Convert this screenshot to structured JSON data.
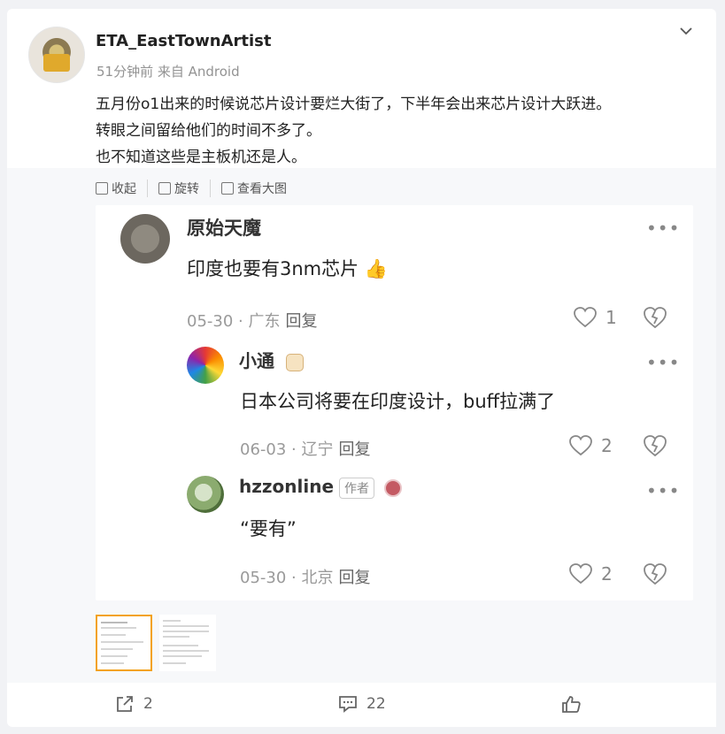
{
  "post": {
    "username": "ETA_EastTownArtist",
    "meta": "51分钟前 来自 Android",
    "lines": [
      "五月份o1出来的时候说芯片设计要烂大街了，下半年会出来芯片设计大跃进。",
      "转眼之间留给他们的时间不多了。",
      "也不知道这些是主板机还是人。"
    ]
  },
  "image_toolbar": {
    "collapse": "收起",
    "rotate": "旋转",
    "view_large": "查看大图"
  },
  "comments": [
    {
      "name": "原始天魔",
      "text": "印度也要有3nm芯片",
      "emoji": "👍",
      "meta": "05-30 · 广东",
      "reply": "回复",
      "likes": "1"
    },
    {
      "name": "小通",
      "text": "日本公司将要在印度设计，buff拉满了",
      "meta": "06-03 · 辽宁",
      "reply": "回复",
      "likes": "2"
    },
    {
      "name": "hzzonline",
      "badge": "作者",
      "text": "“要有”",
      "meta": "05-30 · 北京",
      "reply": "回复",
      "likes": "2"
    }
  ],
  "actions": {
    "share_count": "2",
    "comment_count": "22"
  },
  "colors": {
    "accent": "#f3a21a",
    "background": "#f1f2f5"
  }
}
